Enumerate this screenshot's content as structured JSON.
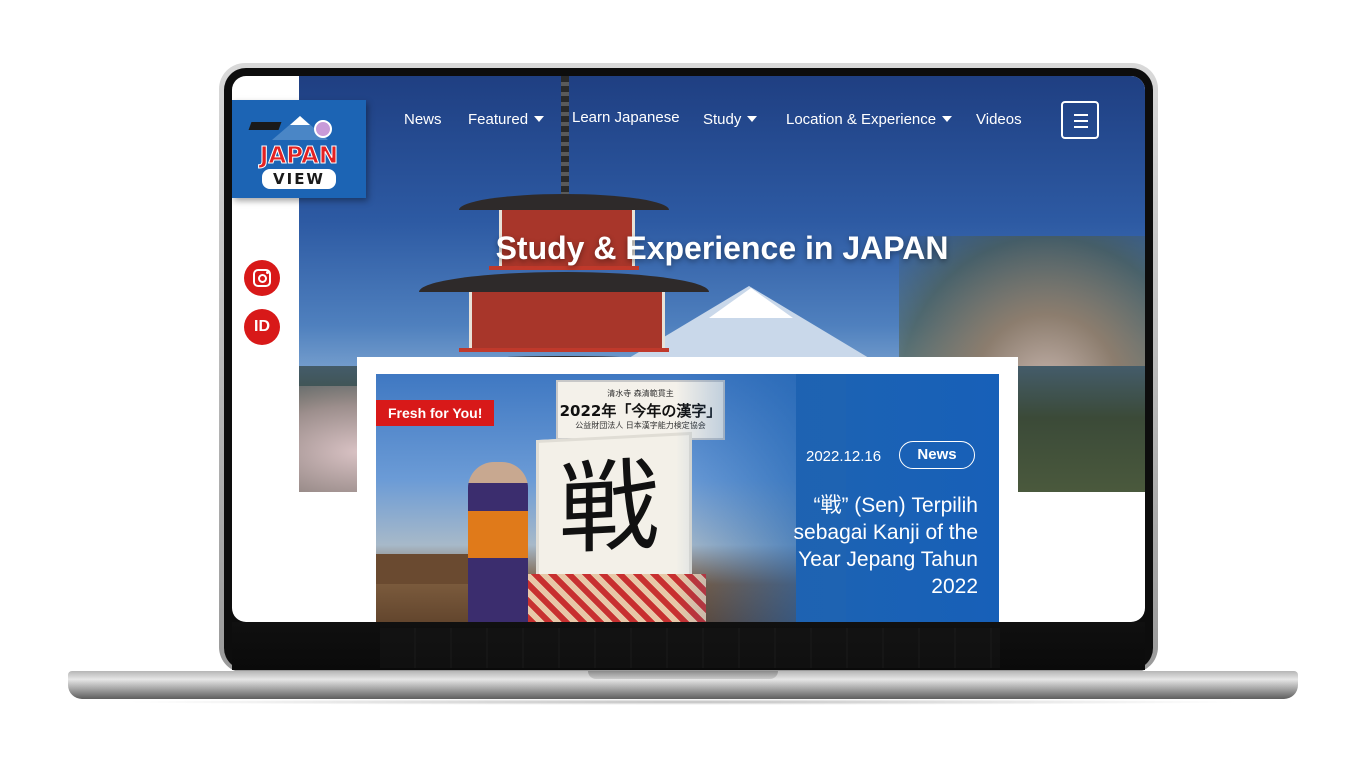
{
  "site": {
    "logo_line1": "JAPAN",
    "logo_line2": "VIEW"
  },
  "nav": {
    "items": [
      {
        "label": "News",
        "dropdown": false
      },
      {
        "label": "Featured",
        "dropdown": true
      },
      {
        "label": "Learn Japanese",
        "dropdown": false
      },
      {
        "label": "Study",
        "dropdown": true
      },
      {
        "label": "Location & Experience",
        "dropdown": true
      },
      {
        "label": "Videos",
        "dropdown": false
      }
    ],
    "menu_icon": "hamburger-icon"
  },
  "sidebar": {
    "social": [
      {
        "icon": "instagram-icon"
      },
      {
        "label": "ID"
      }
    ]
  },
  "hero": {
    "title": "Study & Experience in JAPAN"
  },
  "featured": {
    "badge": "Fresh for You!",
    "date": "2022.12.16",
    "tag": "News",
    "title": "“戦” (Sen) Terpilih sebagai Kanji of the Year Jepang Tahun 2022",
    "image_sign_line1": "清水寺 森清範貫主",
    "image_sign_line2": "2022年「今年の漢字」",
    "image_sign_line3": "公益財団法人 日本漢字能力検定協会",
    "image_kanji": "戦"
  },
  "colors": {
    "brand_blue": "#1c64b4",
    "accent_red": "#d81919",
    "card_blue": "#1760b8"
  }
}
